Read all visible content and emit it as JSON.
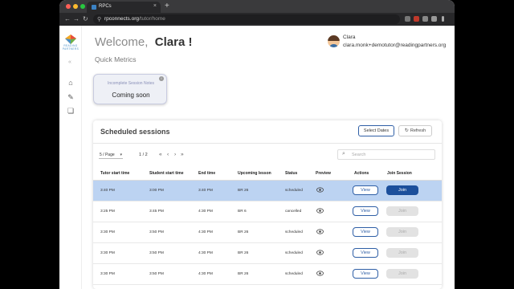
{
  "browser": {
    "tab_title": "RPCs",
    "tab_close": "×",
    "new_tab": "+",
    "url_host": "rpconnects.org",
    "url_path": "/tutor/home",
    "back": "←",
    "forward": "→",
    "reload": "↻",
    "lock": "⚲"
  },
  "sidebar": {
    "logo_text": "READING PARTNERS",
    "collapse": "«",
    "items": [
      {
        "name": "home-icon",
        "glyph": "⌂"
      },
      {
        "name": "edit-note-icon",
        "glyph": "✎"
      },
      {
        "name": "book-icon",
        "glyph": "❏"
      }
    ]
  },
  "header": {
    "welcome_prefix": "Welcome,",
    "user_first_name": "Clara !",
    "user_name": "Clara",
    "user_email": "clara.monk+demotutor@readingpartners.org"
  },
  "quick_metrics": {
    "title": "Quick Metrics",
    "card": {
      "label": "Incomplete Session Notes",
      "value": "Coming soon",
      "info": "i"
    }
  },
  "sessions": {
    "title": "Scheduled sessions",
    "select_dates_label": "Select Dates",
    "refresh_label": "Refresh",
    "refresh_icon": "↻",
    "page_size": "5 / Page",
    "page_size_caret": "▾",
    "page_indicator": "1 / 2",
    "pager": {
      "first": "«",
      "prev": "‹",
      "next": "›",
      "last": "»"
    },
    "search_placeholder": "Search",
    "search_icon": "⌕",
    "columns": [
      "Tutor start time",
      "Student start time",
      "End time",
      "Upcoming lesson",
      "Status",
      "Preview",
      "Actions",
      "Join Session"
    ],
    "view_label": "View",
    "join_label": "Join",
    "rows": [
      {
        "tutor_start": "3:40 PM",
        "student_start": "3:00 PM",
        "end": "3:40 PM",
        "lesson": "BR 26",
        "status": "scheduled",
        "selected": true,
        "join_enabled": true
      },
      {
        "tutor_start": "3:25 PM",
        "student_start": "3:45 PM",
        "end": "4:30 PM",
        "lesson": "BR 6",
        "status": "cancelled",
        "selected": false,
        "join_enabled": false
      },
      {
        "tutor_start": "3:30 PM",
        "student_start": "3:50 PM",
        "end": "4:30 PM",
        "lesson": "BR 26",
        "status": "scheduled",
        "selected": false,
        "join_enabled": false
      },
      {
        "tutor_start": "3:30 PM",
        "student_start": "3:50 PM",
        "end": "4:30 PM",
        "lesson": "BR 26",
        "status": "scheduled",
        "selected": false,
        "join_enabled": false
      },
      {
        "tutor_start": "3:30 PM",
        "student_start": "3:50 PM",
        "end": "4:30 PM",
        "lesson": "BR 26",
        "status": "scheduled",
        "selected": false,
        "join_enabled": false
      }
    ]
  },
  "colors": {
    "accent": "#1c4f9c",
    "selected_row": "#bcd3f2",
    "mac_close": "#ff5f57",
    "mac_min": "#febc2e",
    "mac_max": "#28c840"
  }
}
